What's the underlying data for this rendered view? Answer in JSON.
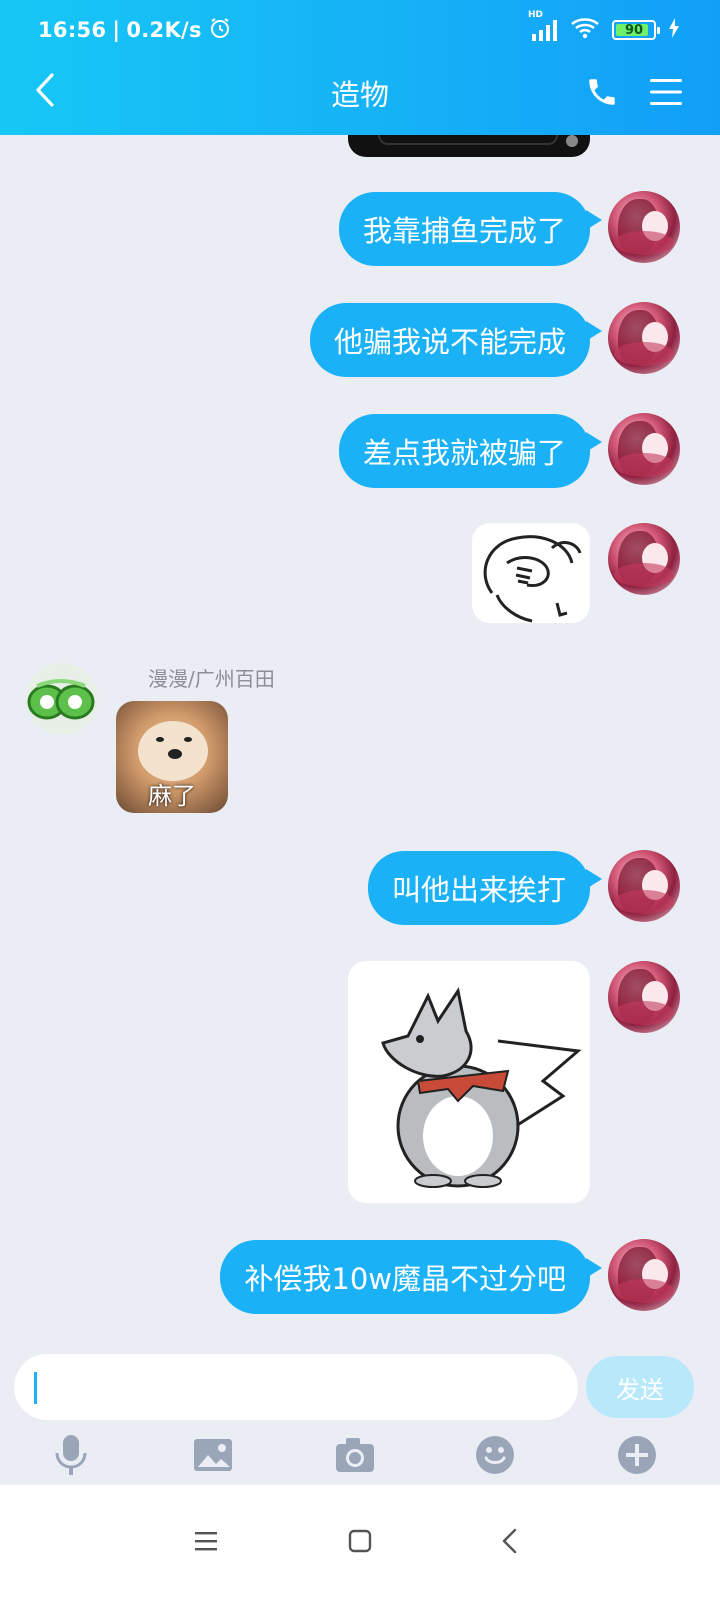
{
  "status_bar": {
    "time": "16:56",
    "separator": "|",
    "net_speed": "0.2K/s",
    "battery": "90",
    "battery_level": 0.9,
    "signal_label": "HD",
    "icons": [
      "alarm-icon",
      "signal-icon",
      "wifi-icon",
      "battery-icon",
      "charging-icon"
    ]
  },
  "header": {
    "title": "造物",
    "icons": [
      "back-icon",
      "phone-icon",
      "menu-icon"
    ]
  },
  "messages": [
    {
      "type": "sticker-partial",
      "side": "right"
    },
    {
      "type": "text",
      "side": "right",
      "text": "我靠捕鱼完成了"
    },
    {
      "type": "text",
      "side": "right",
      "text": "他骗我说不能完成"
    },
    {
      "type": "text",
      "side": "right",
      "text": "差点我就被骗了"
    },
    {
      "type": "sticker",
      "side": "right",
      "name": "facepalm-sticker"
    },
    {
      "type": "image",
      "side": "left",
      "sender": "漫漫/广州百田",
      "caption": "麻了"
    },
    {
      "type": "text",
      "side": "right",
      "text": "叫他出来挨打"
    },
    {
      "type": "sticker",
      "side": "right",
      "name": "wolf-pikachu-sticker"
    },
    {
      "type": "text",
      "side": "right",
      "text": "补偿我10w魔晶不过分吧"
    }
  ],
  "input": {
    "value": "",
    "send_label": "发送"
  },
  "toolbar": [
    "microphone-icon",
    "picture-icon",
    "camera-icon",
    "emoji-icon",
    "plus-icon"
  ],
  "system_nav": [
    "recent-apps-icon",
    "home-icon",
    "back-nav-icon"
  ],
  "colors": {
    "header_start": "#16c7f5",
    "header_end": "#129ff8",
    "bubble": "#1ab1f7",
    "background": "#eaedf4",
    "send_disabled": "#b8e9fb"
  }
}
